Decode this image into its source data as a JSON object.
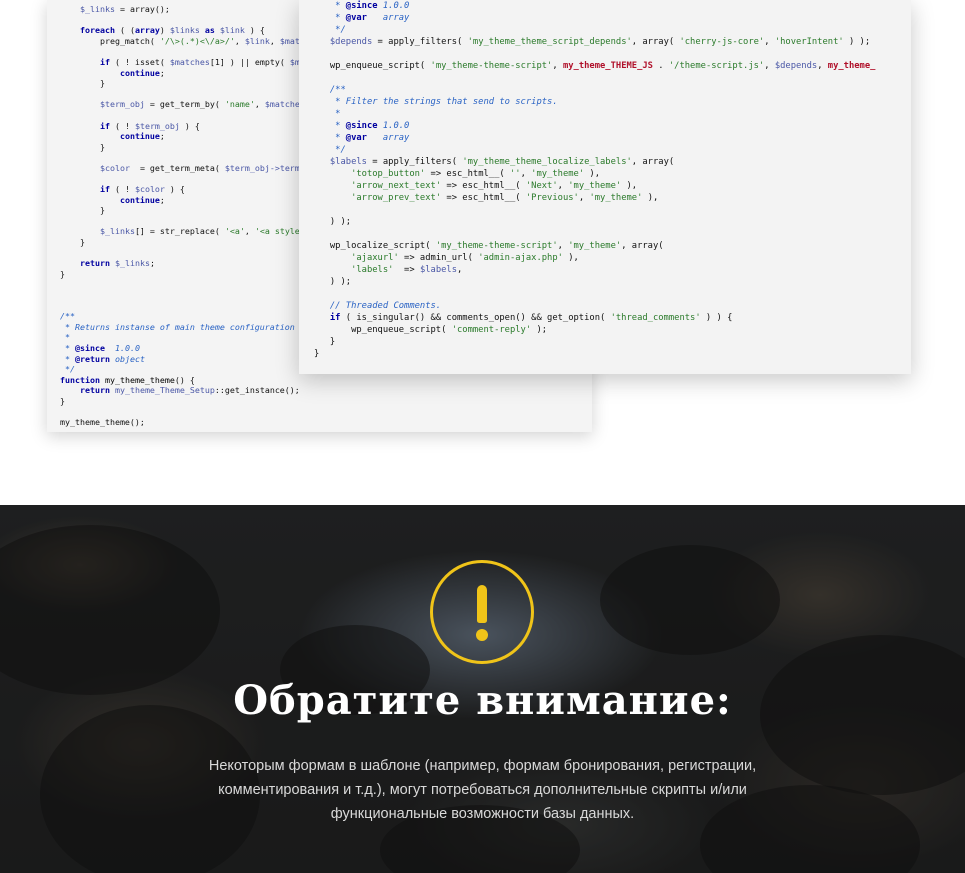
{
  "code_back": {
    "lines": [
      [
        {
          "t": "    "
        },
        {
          "c": "var",
          "t": "$_links"
        },
        {
          "t": " = array();"
        }
      ],
      [
        {
          "t": ""
        }
      ],
      [
        {
          "t": "    "
        },
        {
          "c": "kw",
          "t": "foreach"
        },
        {
          "t": " ( ("
        },
        {
          "c": "kw",
          "t": "array"
        },
        {
          "t": ") "
        },
        {
          "c": "var",
          "t": "$links"
        },
        {
          "t": " "
        },
        {
          "c": "kw",
          "t": "as"
        },
        {
          "t": " "
        },
        {
          "c": "var",
          "t": "$link"
        },
        {
          "t": " ) {"
        }
      ],
      [
        {
          "t": "        preg_match( "
        },
        {
          "c": "str",
          "t": "'/\\>(.*)<\\/a>/'"
        },
        {
          "t": ", "
        },
        {
          "c": "var",
          "t": "$link"
        },
        {
          "t": ", "
        },
        {
          "c": "var",
          "t": "$mat"
        }
      ],
      [
        {
          "t": ""
        }
      ],
      [
        {
          "t": "        "
        },
        {
          "c": "kw",
          "t": "if"
        },
        {
          "t": " ( ! isset( "
        },
        {
          "c": "var",
          "t": "$matches"
        },
        {
          "t": "[1] ) || empty( "
        },
        {
          "c": "var",
          "t": "$m"
        }
      ],
      [
        {
          "t": "            "
        },
        {
          "c": "kw",
          "t": "continue"
        },
        {
          "t": ";"
        }
      ],
      [
        {
          "t": "        }"
        }
      ],
      [
        {
          "t": ""
        }
      ],
      [
        {
          "t": "        "
        },
        {
          "c": "var",
          "t": "$term_obj"
        },
        {
          "t": " = get_term_by( "
        },
        {
          "c": "str",
          "t": "'name'"
        },
        {
          "t": ", "
        },
        {
          "c": "var",
          "t": "$matche"
        }
      ],
      [
        {
          "t": ""
        }
      ],
      [
        {
          "t": "        "
        },
        {
          "c": "kw",
          "t": "if"
        },
        {
          "t": " ( ! "
        },
        {
          "c": "var",
          "t": "$term_obj"
        },
        {
          "t": " ) {"
        }
      ],
      [
        {
          "t": "            "
        },
        {
          "c": "kw",
          "t": "continue"
        },
        {
          "t": ";"
        }
      ],
      [
        {
          "t": "        }"
        }
      ],
      [
        {
          "t": ""
        }
      ],
      [
        {
          "t": "        "
        },
        {
          "c": "var",
          "t": "$color"
        },
        {
          "t": "  = get_term_meta( "
        },
        {
          "c": "var",
          "t": "$term_obj->term"
        }
      ],
      [
        {
          "t": ""
        }
      ],
      [
        {
          "t": "        "
        },
        {
          "c": "kw",
          "t": "if"
        },
        {
          "t": " ( ! "
        },
        {
          "c": "var",
          "t": "$color"
        },
        {
          "t": " ) {"
        }
      ],
      [
        {
          "t": "            "
        },
        {
          "c": "kw",
          "t": "continue"
        },
        {
          "t": ";"
        }
      ],
      [
        {
          "t": "        }"
        }
      ],
      [
        {
          "t": ""
        }
      ],
      [
        {
          "t": "        "
        },
        {
          "c": "var",
          "t": "$_links"
        },
        {
          "t": "[] = str_replace( "
        },
        {
          "c": "str",
          "t": "'<a'"
        },
        {
          "t": ", "
        },
        {
          "c": "str",
          "t": "'<a style"
        }
      ],
      [
        {
          "t": "    }"
        }
      ],
      [
        {
          "t": ""
        }
      ],
      [
        {
          "t": "    "
        },
        {
          "c": "kw",
          "t": "return"
        },
        {
          "t": " "
        },
        {
          "c": "var",
          "t": "$_links"
        },
        {
          "t": ";"
        }
      ],
      [
        {
          "t": "}"
        }
      ],
      [
        {
          "t": ""
        }
      ],
      [
        {
          "t": ""
        }
      ],
      [
        {
          "t": ""
        }
      ],
      [
        {
          "c": "cmt",
          "t": "/**"
        }
      ],
      [
        {
          "c": "cmt",
          "t": " * Returns instanse of main theme configuration c"
        }
      ],
      [
        {
          "c": "cmt",
          "t": " *"
        }
      ],
      [
        {
          "c": "cmt",
          "t": " * "
        },
        {
          "c": "cmt-tag",
          "t": "@since"
        },
        {
          "c": "cmt",
          "t": "  1.0.0"
        }
      ],
      [
        {
          "c": "cmt",
          "t": " * "
        },
        {
          "c": "cmt-tag",
          "t": "@return"
        },
        {
          "c": "cmt",
          "t": " object"
        }
      ],
      [
        {
          "c": "cmt",
          "t": " */"
        }
      ],
      [
        {
          "c": "kw",
          "t": "function"
        },
        {
          "t": " "
        },
        {
          "c": "fn",
          "t": "my_theme_theme"
        },
        {
          "t": "() {"
        }
      ],
      [
        {
          "t": "    "
        },
        {
          "c": "kw",
          "t": "return"
        },
        {
          "t": " "
        },
        {
          "c": "var",
          "t": "my_theme_Theme_Setup"
        },
        {
          "t": "::get_instance();"
        }
      ],
      [
        {
          "t": "}"
        }
      ],
      [
        {
          "t": ""
        }
      ],
      [
        {
          "t": "my_theme_theme();"
        }
      ]
    ]
  },
  "code_front": {
    "lines": [
      [
        {
          "c": "cmt",
          "t": "    * "
        },
        {
          "c": "cmt-tag",
          "t": "@since"
        },
        {
          "c": "cmt",
          "t": " 1.0.0"
        }
      ],
      [
        {
          "c": "cmt",
          "t": "    * "
        },
        {
          "c": "cmt-tag",
          "t": "@var"
        },
        {
          "c": "cmt",
          "t": "   array"
        }
      ],
      [
        {
          "c": "cmt",
          "t": "    */"
        }
      ],
      [
        {
          "t": "   "
        },
        {
          "c": "var",
          "t": "$depends"
        },
        {
          "t": " = apply_filters( "
        },
        {
          "c": "str",
          "t": "'my_theme_theme_script_depends'"
        },
        {
          "t": ", array( "
        },
        {
          "c": "str",
          "t": "'cherry-js-core'"
        },
        {
          "t": ", "
        },
        {
          "c": "str",
          "t": "'hoverIntent'"
        },
        {
          "t": " ) );"
        }
      ],
      [
        {
          "t": ""
        }
      ],
      [
        {
          "t": "   wp_enqueue_script( "
        },
        {
          "c": "str",
          "t": "'my_theme-theme-script'"
        },
        {
          "t": ", "
        },
        {
          "c": "const",
          "t": "my_theme_THEME_JS"
        },
        {
          "t": " . "
        },
        {
          "c": "str",
          "t": "'/theme-script.js'"
        },
        {
          "t": ", "
        },
        {
          "c": "var",
          "t": "$depends"
        },
        {
          "t": ", "
        },
        {
          "c": "const",
          "t": "my_theme_"
        }
      ],
      [
        {
          "t": ""
        }
      ],
      [
        {
          "c": "cmt",
          "t": "   /**"
        }
      ],
      [
        {
          "c": "cmt",
          "t": "    * Filter the strings that send to scripts."
        }
      ],
      [
        {
          "c": "cmt",
          "t": "    *"
        }
      ],
      [
        {
          "c": "cmt",
          "t": "    * "
        },
        {
          "c": "cmt-tag",
          "t": "@since"
        },
        {
          "c": "cmt",
          "t": " 1.0.0"
        }
      ],
      [
        {
          "c": "cmt",
          "t": "    * "
        },
        {
          "c": "cmt-tag",
          "t": "@var"
        },
        {
          "c": "cmt",
          "t": "   array"
        }
      ],
      [
        {
          "c": "cmt",
          "t": "    */"
        }
      ],
      [
        {
          "t": "   "
        },
        {
          "c": "var",
          "t": "$labels"
        },
        {
          "t": " = apply_filters( "
        },
        {
          "c": "str",
          "t": "'my_theme_theme_localize_labels'"
        },
        {
          "t": ", array("
        }
      ],
      [
        {
          "t": "       "
        },
        {
          "c": "str",
          "t": "'totop_button'"
        },
        {
          "t": " => esc_html__( "
        },
        {
          "c": "str",
          "t": "''"
        },
        {
          "t": ", "
        },
        {
          "c": "str",
          "t": "'my_theme'"
        },
        {
          "t": " ),"
        }
      ],
      [
        {
          "t": "       "
        },
        {
          "c": "str",
          "t": "'arrow_next_text'"
        },
        {
          "t": " => esc_html__( "
        },
        {
          "c": "str",
          "t": "'Next'"
        },
        {
          "t": ", "
        },
        {
          "c": "str",
          "t": "'my_theme'"
        },
        {
          "t": " ),"
        }
      ],
      [
        {
          "t": "       "
        },
        {
          "c": "str",
          "t": "'arrow_prev_text'"
        },
        {
          "t": " => esc_html__( "
        },
        {
          "c": "str",
          "t": "'Previous'"
        },
        {
          "t": ", "
        },
        {
          "c": "str",
          "t": "'my_theme'"
        },
        {
          "t": " ),"
        }
      ],
      [
        {
          "t": ""
        }
      ],
      [
        {
          "t": "   ) );"
        }
      ],
      [
        {
          "t": ""
        }
      ],
      [
        {
          "t": "   wp_localize_script( "
        },
        {
          "c": "str",
          "t": "'my_theme-theme-script'"
        },
        {
          "t": ", "
        },
        {
          "c": "str",
          "t": "'my_theme'"
        },
        {
          "t": ", array("
        }
      ],
      [
        {
          "t": "       "
        },
        {
          "c": "str",
          "t": "'ajaxurl'"
        },
        {
          "t": " => admin_url( "
        },
        {
          "c": "str",
          "t": "'admin-ajax.php'"
        },
        {
          "t": " ),"
        }
      ],
      [
        {
          "t": "       "
        },
        {
          "c": "str",
          "t": "'labels'"
        },
        {
          "t": "  => "
        },
        {
          "c": "var",
          "t": "$labels"
        },
        {
          "t": ","
        }
      ],
      [
        {
          "t": "   ) );"
        }
      ],
      [
        {
          "t": ""
        }
      ],
      [
        {
          "c": "cmt",
          "t": "   // Threaded Comments."
        }
      ],
      [
        {
          "t": "   "
        },
        {
          "c": "kw",
          "t": "if"
        },
        {
          "t": " ( is_singular() && comments_open() && get_option( "
        },
        {
          "c": "str",
          "t": "'thread_comments'"
        },
        {
          "t": " ) ) {"
        }
      ],
      [
        {
          "t": "       wp_enqueue_script( "
        },
        {
          "c": "str",
          "t": "'comment-reply'"
        },
        {
          "t": " );"
        }
      ],
      [
        {
          "t": "   }"
        }
      ],
      [
        {
          "t": "}"
        }
      ]
    ]
  },
  "notice": {
    "heading": "Обратите внимание:",
    "description": "Некоторым формам в шаблоне (например, формам бронирования, регистрации, комментирования и т.д.), могут потребоваться дополнительные скрипты и/или функциональные возможности базы данных.",
    "icon": "exclamation-circle-icon",
    "accent_color": "#f0c419"
  }
}
